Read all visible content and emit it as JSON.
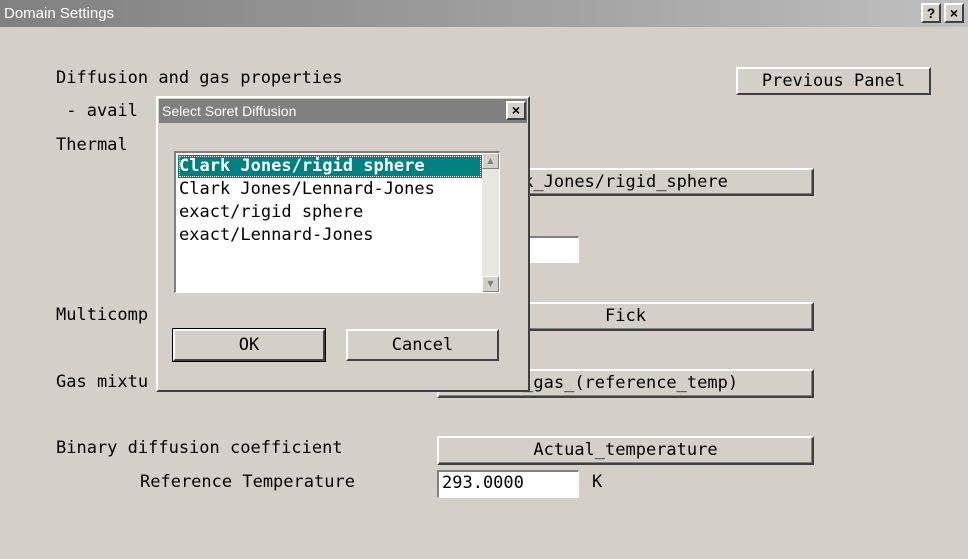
{
  "window": {
    "title": "Domain Settings",
    "help_label": "?",
    "close_label": "×"
  },
  "panel": {
    "diffusion_heading": "Diffusion and gas properties",
    "available_label": " - avail",
    "thermal_label": "Thermal",
    "previous_panel_label": "Previous Panel",
    "thermal_value": "k_Jones/rigid_sphere",
    "thermal_field_value": "",
    "multicomponent_label": "Multicomp",
    "multicomponent_value": "Fick",
    "gas_mixture_label": "Gas mixtu",
    "gas_mixture_value": "r_gas_(reference_temp)",
    "binary_diffusion_label": "Binary diffusion coefficient",
    "binary_diffusion_value": "Actual_temperature",
    "reference_temp_label": "Reference Temperature",
    "reference_temp_value": "293.0000",
    "reference_temp_unit": "K"
  },
  "dialog": {
    "title": "Select Soret Diffusion",
    "close_label": "×",
    "items": [
      "Clark Jones/rigid sphere",
      "Clark Jones/Lennard-Jones",
      "exact/rigid sphere",
      "exact/Lennard-Jones"
    ],
    "selected_index": 0,
    "ok_label": "OK",
    "cancel_label": "Cancel",
    "scroll_up": "▲",
    "scroll_down": "▼"
  }
}
